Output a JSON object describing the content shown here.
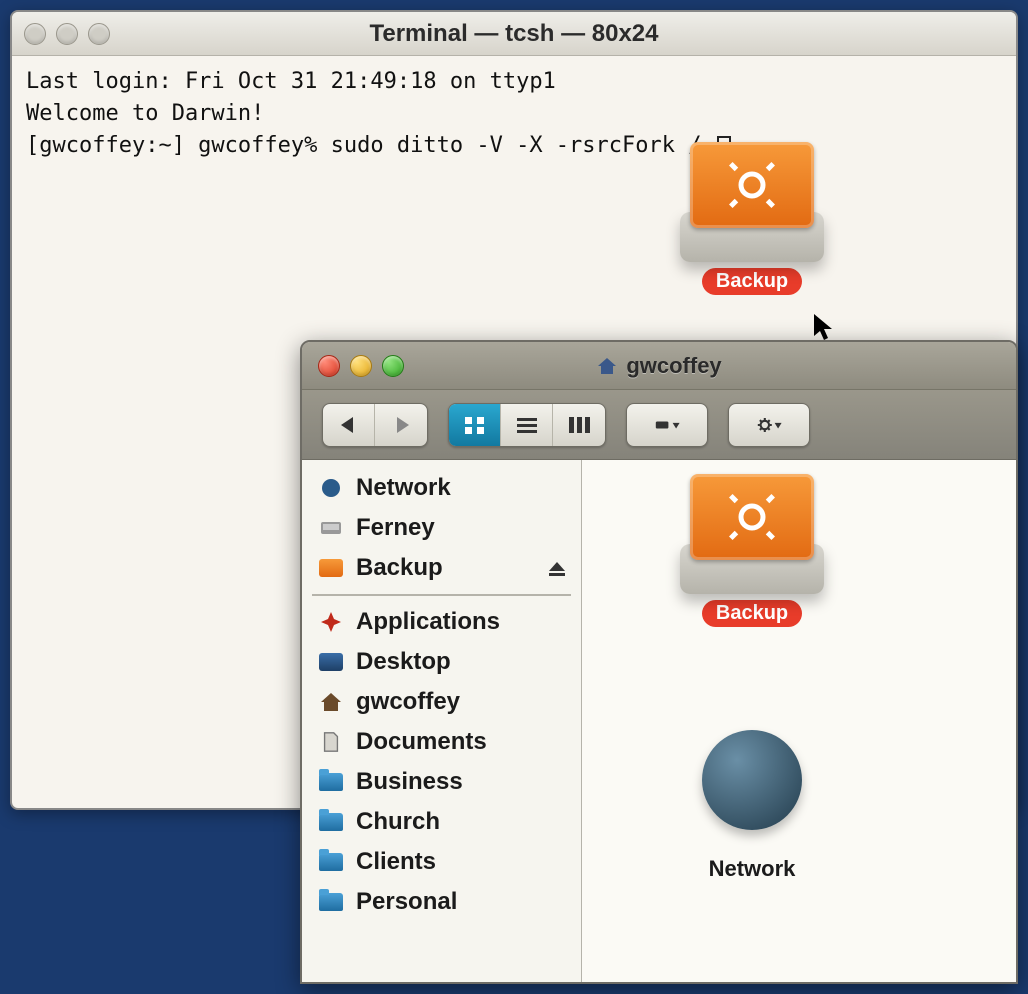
{
  "terminal": {
    "title": "Terminal — tcsh — 80x24",
    "line1": "Last login: Fri Oct 31 21:49:18 on ttyp1",
    "line2": "Welcome to Darwin!",
    "prompt": "[gwcoffey:~] gwcoffey% ",
    "command": "sudo ditto -V -X -rsrcFork / "
  },
  "desktop_drive": {
    "label": "Backup",
    "firewire_glyph": "firewire-icon"
  },
  "finder": {
    "title": "gwcoffey",
    "toolbar": {
      "back": "◀",
      "forward": "▶",
      "view_icon": "icon-view",
      "view_list": "list-view",
      "view_column": "column-view",
      "action": "✦",
      "gear": "⚙"
    },
    "sidebar": {
      "top": [
        {
          "icon": "network-icon",
          "label": "Network"
        },
        {
          "icon": "hdd-icon",
          "label": "Ferney"
        },
        {
          "icon": "firewire-drive-icon",
          "label": "Backup",
          "eject": true
        }
      ],
      "bottom": [
        {
          "icon": "applications-icon",
          "label": "Applications"
        },
        {
          "icon": "desktop-icon",
          "label": "Desktop"
        },
        {
          "icon": "home-icon",
          "label": "gwcoffey"
        },
        {
          "icon": "documents-icon",
          "label": "Documents"
        },
        {
          "icon": "folder-icon",
          "label": "Business"
        },
        {
          "icon": "folder-icon",
          "label": "Church"
        },
        {
          "icon": "folder-icon",
          "label": "Clients"
        },
        {
          "icon": "folder-icon",
          "label": "Personal"
        }
      ]
    },
    "content": {
      "drive_label": "Backup",
      "network_label": "Network"
    }
  }
}
